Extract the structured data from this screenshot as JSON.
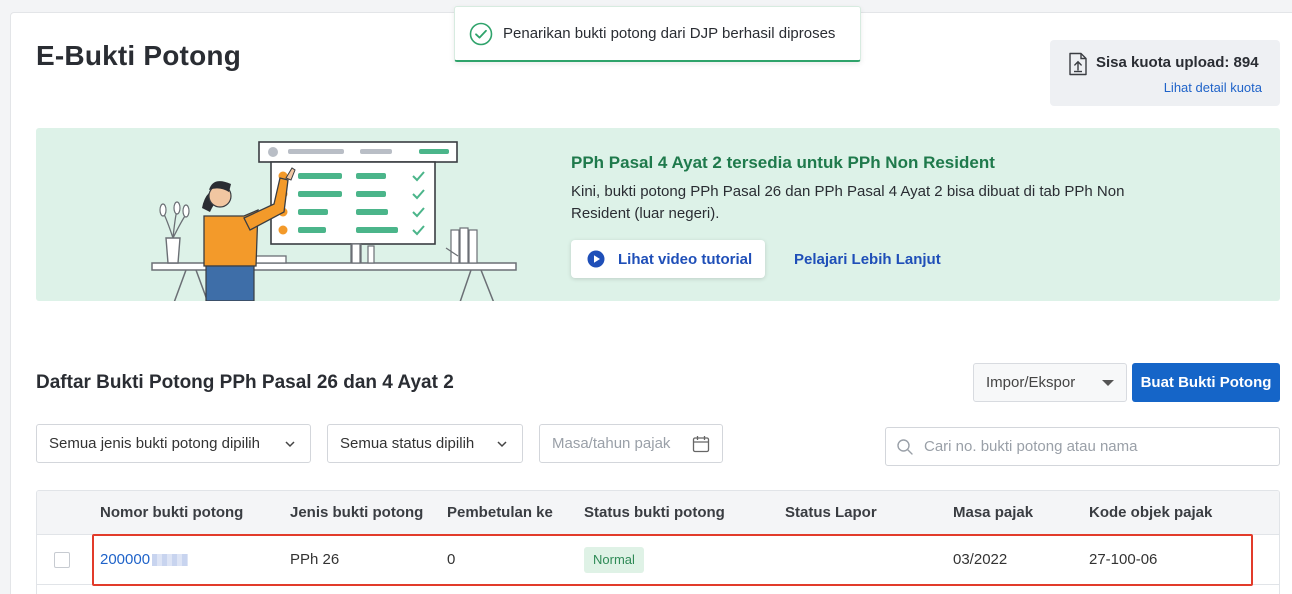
{
  "page": {
    "title": "E-Bukti Potong"
  },
  "toast": {
    "message": "Penarikan bukti potong dari DJP berhasil diproses",
    "color": "#2fa36b"
  },
  "quota": {
    "label": "Sisa kuota upload: 894",
    "link": "Lihat detail kuota"
  },
  "banner": {
    "title": "PPh Pasal 4 Ayat 2 tersedia untuk PPh Non Resident",
    "description": "Kini, bukti potong PPh Pasal 26 dan PPh Pasal 4 Ayat 2 bisa dibuat di tab PPh Non Resident (luar negeri).",
    "video_button": "Lihat video tutorial",
    "learn_more": "Pelajari Lebih Lanjut",
    "background": "#ddf2e8"
  },
  "section": {
    "title": "Daftar Bukti Potong PPh Pasal 26 dan 4 Ayat 2",
    "import_export": "Impor/Ekspor",
    "create_button": "Buat Bukti Potong"
  },
  "filters": {
    "type": "Semua jenis bukti potong dipilih",
    "status": "Semua status dipilih",
    "period_placeholder": "Masa/tahun pajak",
    "search_placeholder": "Cari no. bukti potong atau nama"
  },
  "table": {
    "headers": [
      "Nomor bukti potong",
      "Jenis bukti potong",
      "Pembetulan ke",
      "Status bukti potong",
      "Status Lapor",
      "Masa pajak",
      "Kode objek pajak"
    ],
    "rows": [
      {
        "number": "200000",
        "type": "PPh 26",
        "revision": "0",
        "status": "Normal",
        "report_status": "",
        "period": "03/2022",
        "tax_code": "27-100-06"
      }
    ]
  },
  "colors": {
    "primary": "#1565c8",
    "highlight": "#e23b2a",
    "success": "#2e8a56"
  }
}
